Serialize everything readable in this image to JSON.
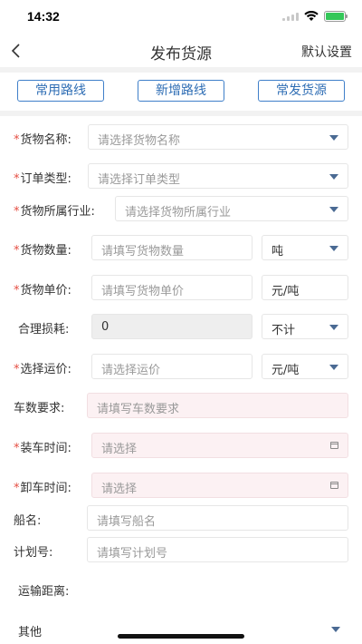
{
  "status": {
    "time": "14:32"
  },
  "nav": {
    "title": "发布货源",
    "right_action": "默认设置"
  },
  "route_buttons": {
    "common": "常用路线",
    "add": "新增路线",
    "frequent": "常发货源"
  },
  "form": {
    "cargo_name": {
      "label": "货物名称:",
      "placeholder": "请选择货物名称",
      "required": true
    },
    "order_type": {
      "label": "订单类型:",
      "placeholder": "请选择订单类型",
      "required": true
    },
    "industry": {
      "label": "货物所属行业:",
      "placeholder": "请选择货物所属行业",
      "required": true
    },
    "quantity": {
      "label": "货物数量:",
      "placeholder": "请填写货物数量",
      "unit": "吨",
      "required": true
    },
    "unit_price": {
      "label": "货物单价:",
      "placeholder": "请填写货物单价",
      "unit": "元/吨",
      "required": true
    },
    "loss": {
      "label": "合理损耗:",
      "value": "0",
      "unit": "不计",
      "required": false
    },
    "freight": {
      "label": "选择运价:",
      "placeholder": "请选择运价",
      "unit": "元/吨",
      "required": true
    },
    "trucks": {
      "label": "车数要求:",
      "placeholder": "请填写车数要求",
      "required": false
    },
    "load_time": {
      "label": "装车时间:",
      "placeholder": "请选择",
      "required": true
    },
    "unload_time": {
      "label": "卸车时间:",
      "placeholder": "请选择",
      "required": true
    },
    "ship_name": {
      "label": "船名:",
      "placeholder": "请填写船名"
    },
    "plan_no": {
      "label": "计划号:",
      "placeholder": "请填写计划号"
    },
    "distance": {
      "label": "运输距离:"
    },
    "other": {
      "label": "其他"
    }
  }
}
